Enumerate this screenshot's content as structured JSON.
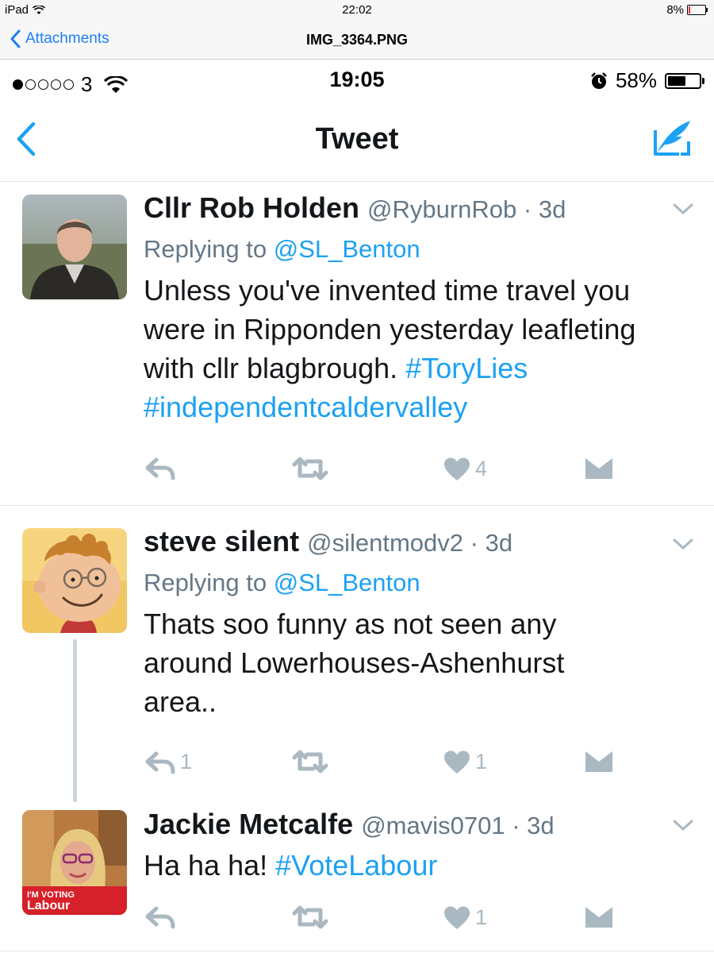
{
  "ipad_status": {
    "device": "iPad",
    "time": "22:02",
    "battery": "8%"
  },
  "viewer": {
    "back_label": "Attachments",
    "title": "IMG_3364.PNG"
  },
  "phone_status": {
    "carrier": "3",
    "time": "19:05",
    "battery": "58%",
    "signal_bars": 1,
    "battery_level": 0.58
  },
  "header": {
    "title": "Tweet"
  },
  "tweets": [
    {
      "name": "Cllr Rob Holden",
      "handle": "@RyburnRob",
      "age": "3d",
      "replying_prefix": "Replying to",
      "replying_to": "@SL_Benton",
      "text": "Unless you've invented time travel you were in Ripponden yesterday leafleting with cllr blagbrough.",
      "hashtag_line": "#ToryLies #independentcaldervalley",
      "reply_count": "",
      "retweet_count": "",
      "like_count": "4"
    },
    {
      "name": "steve silent",
      "handle": "@silentmodv2",
      "age": "3d",
      "replying_prefix": "Replying to",
      "replying_to": "@SL_Benton",
      "text": "Thats soo funny as not seen any around Lowerhouses-Ashenhurst area..",
      "reply_count": "1",
      "retweet_count": "",
      "like_count": "1"
    },
    {
      "name": "Jackie Metcalfe",
      "handle": "@mavis0701",
      "age": "3d",
      "text_prefix": "Ha ha ha!",
      "hashtag": "#VoteLabour",
      "badge_line1": "I'M VOTING",
      "badge_line2": "Labour",
      "reply_count": "",
      "retweet_count": "",
      "like_count": "1"
    }
  ],
  "colors": {
    "link": "#1da1f2",
    "ios_blue": "#1e7ff5",
    "muted": "#657786",
    "icon_gray": "#aab8c2",
    "labour_red": "#d6202a"
  },
  "icons": [
    "wifi-icon",
    "back-chevron-icon",
    "compose-icon",
    "caret-down-icon",
    "reply-icon",
    "retweet-icon",
    "like-icon",
    "dm-icon",
    "alarm-icon",
    "battery-icon"
  ]
}
